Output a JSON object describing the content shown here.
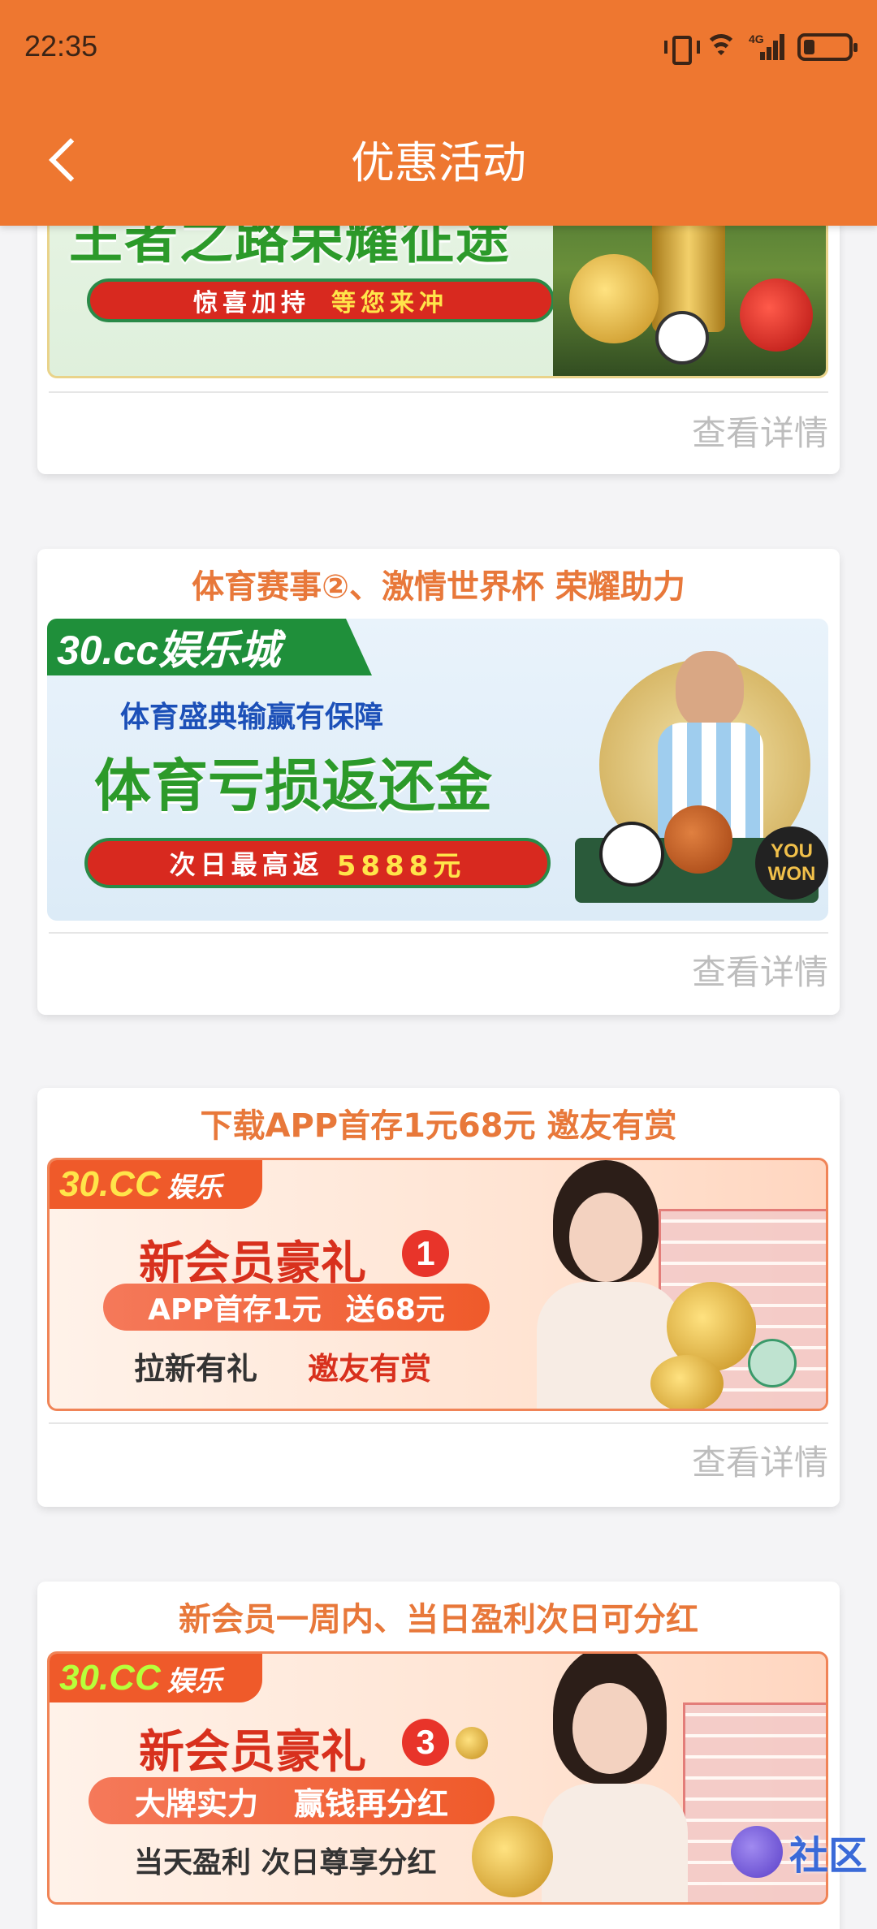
{
  "status_bar": {
    "time": "22:35",
    "network": "4G"
  },
  "header": {
    "title": "优惠活动"
  },
  "more_label": "查看详情",
  "cards": [
    {
      "title": "",
      "banner": {
        "headline": "王者之路荣耀征途",
        "pill_left": "惊喜加持",
        "pill_right": "等您来冲"
      }
    },
    {
      "title": "体育赛事②、激情世界杯 荣耀助力",
      "banner": {
        "brand": "30.cc娱乐城",
        "subhead": "体育盛典输赢有保障",
        "headline": "体育亏损返还金",
        "pill_left": "次日最高返",
        "pill_right": "5888元",
        "badge": "YOU WON"
      }
    },
    {
      "title": "下载APP首存1元68元 邀友有赏",
      "banner": {
        "brand": "30.CC",
        "brand2": "娱乐",
        "headline": "新会员豪礼",
        "num": "1",
        "pill_left": "APP首存1元",
        "pill_right": "送68元",
        "line_a": "拉新有礼",
        "line_b": "邀友有赏"
      }
    },
    {
      "title": "新会员一周内、当日盈利次日可分红",
      "banner": {
        "brand": "30.CC",
        "brand2": "娱乐",
        "headline": "新会员豪礼",
        "num": "3",
        "pill_left": "大牌实力",
        "pill_right": "赢钱再分红",
        "line_a": "当天盈利 次日尊享分红"
      }
    }
  ],
  "watermark": "社区"
}
